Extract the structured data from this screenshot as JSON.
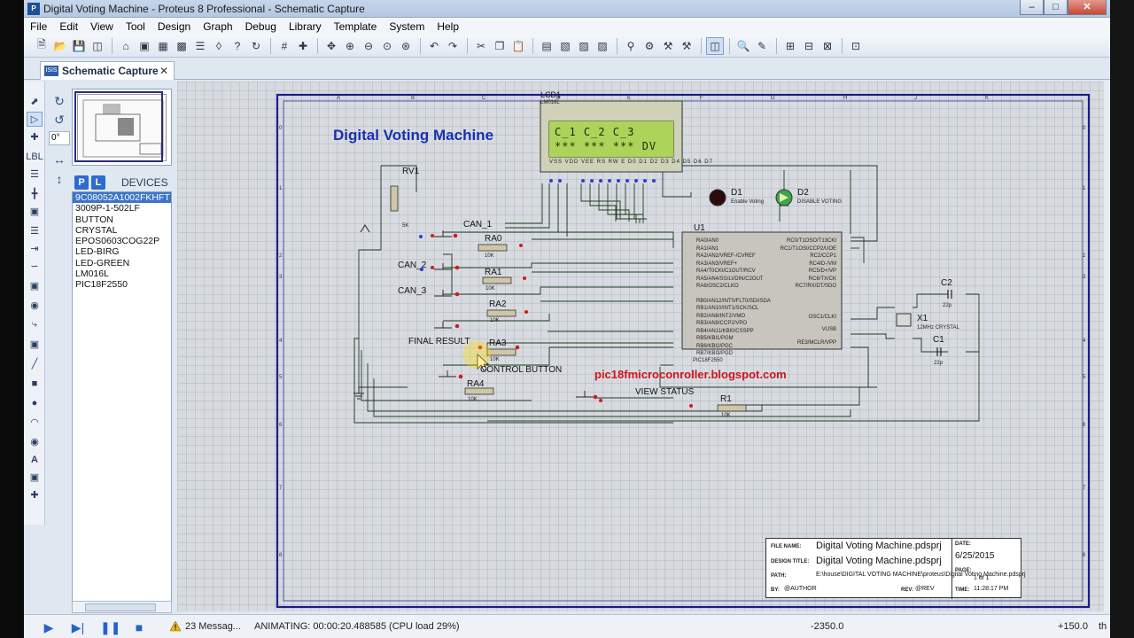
{
  "window": {
    "title": "Digital Voting Machine - Proteus 8 Professional - Schematic Capture",
    "controls": [
      "minimize",
      "maximize",
      "close"
    ]
  },
  "menu": [
    "File",
    "Edit",
    "View",
    "Tool",
    "Design",
    "Graph",
    "Debug",
    "Library",
    "Template",
    "System",
    "Help"
  ],
  "toolbar_icons": [
    "new-icon",
    "open-icon",
    "save-icon",
    "close-project-icon",
    "home-icon",
    "schematic-icon",
    "pcb-icon",
    "gerber-icon",
    "bom-icon",
    "3d-icon",
    "help-icon",
    "refresh-icon",
    "grid-icon",
    "origin-icon",
    "pan-icon",
    "zoom-in-icon",
    "zoom-out-icon",
    "zoom-all-icon",
    "zoom-area-icon",
    "undo-icon",
    "redo-icon",
    "cut-icon",
    "copy-icon",
    "paste-icon",
    "block-copy-icon",
    "block-move-icon",
    "block-rotate-icon",
    "block-delete-icon",
    "pick-icon",
    "make-device-icon",
    "packaging-icon",
    "decompose-icon",
    "wire-autorouter-icon",
    "search-icon",
    "property-assign-icon",
    "new-sheet-icon",
    "remove-sheet-icon",
    "netlist-icon"
  ],
  "tab": {
    "label": "Schematic Capture",
    "badge": "ISIS"
  },
  "overview": {
    "angle": "0°"
  },
  "devices": {
    "buttons": [
      "P",
      "L"
    ],
    "title": "DEVICES",
    "items": [
      "9C08052A1002FKHFT",
      "3009P-1-502LF",
      "BUTTON",
      "CRYSTAL",
      "EPOS0603COG22P",
      "LED-BIRG",
      "LED-GREEN",
      "LM016L",
      "PIC18F2550"
    ],
    "selected_index": 0
  },
  "schematic": {
    "title": "Digital Voting Machine",
    "blog": "pic18fmicroconroller.blogspot.com",
    "lcd": {
      "ref": "LCD1",
      "part": "LM016L",
      "line1": "C_1  C_2  C_3",
      "line2": "***  ***  *** DV",
      "pins": "VSS VDD VEE RS RW E D0 D1 D2 D3 D4 D5 D6 D7"
    },
    "labels": {
      "rv1": "RV1",
      "can1": "CAN_1",
      "can2": "CAN_2",
      "can3": "CAN_3",
      "final": "FINAL RESULT",
      "control": "CONTROL BUTTON",
      "view": "VIEW STATUS",
      "ra0": "RA0",
      "ra1": "RA1",
      "ra2": "RA2",
      "ra3": "RA3",
      "ra4": "RA4",
      "r1": "R1",
      "u1": "U1",
      "u1part": "PIC18F2550",
      "d1": "D1",
      "d1desc": "Enable Voting",
      "d2": "D2",
      "d2desc": "DISABLE VOTING",
      "x1": "X1",
      "x1desc": "12MHz CRYSTAL",
      "c1": "C1",
      "c2": "C2",
      "cap": "22p",
      "res": "10K",
      "rv1val": "5K"
    },
    "u1_left_pins": [
      "RA0/AN0",
      "RA1/AN1",
      "RA2/AN2/VREF-/CVREF",
      "RA3/AN3/VREF+",
      "RA4/T0CKI/C1OUT/RCV",
      "RA5/AN4/SS/LVDIN/C2OUT",
      "RA6/OSC2/CLKO",
      "RB0/AN12/INT0/FLT0/SDI/SDA",
      "RB1/AN10/INT1/SCK/SCL",
      "RB2/AN8/INT2/VMO",
      "RB3/AN9/CCP2/VPO",
      "RB4/AN11/KBI0/CSSPP",
      "RB5/KBI1/PGM",
      "RB6/KBI2/PGC",
      "RB7/KBI3/PGD"
    ],
    "u1_right_pins": [
      "RC0/T1OSO/T13CKI",
      "RC1/T1OSI/CCP2/UOE",
      "RC2/CCP1",
      "RC4/D-/VM",
      "RC5/D+/VP",
      "RC6/TX/CK",
      "RC7/RX/DT/SDO",
      "OSC1/CLKI",
      "VUSB",
      "RE3/MCLR/VPP"
    ],
    "grid_cols": [
      "A",
      "B",
      "C",
      "D",
      "E",
      "F",
      "G",
      "H",
      "J",
      "K"
    ],
    "grid_rows": [
      "0",
      "1",
      "2",
      "3",
      "4",
      "5",
      "6",
      "7",
      "8"
    ]
  },
  "title_block": {
    "file_name_label": "FILE NAME:",
    "file_name": "Digital Voting Machine.pdsprj",
    "design_title_label": "DESIGN TITLE:",
    "design_title": "Digital Voting Machine.pdsprj",
    "path_label": "PATH:",
    "path": "E:\\house\\DIGITAL VOTING MACHINE\\proteus\\Digital Voting Machine.pdsprj",
    "by_label": "BY:",
    "by": "@AUTHOR",
    "rev_label": "REV:",
    "rev": "@REV",
    "date_label": "DATE:",
    "date": "6/25/2015",
    "page_label": "PAGE:",
    "page": "1 of 1",
    "time_label": "TIME:",
    "time": "11:28:17 PM"
  },
  "status": {
    "messages": "23 Messag...",
    "animating": "ANIMATING: 00:00:20.488585 (CPU load 29%)",
    "x": "-2350.0",
    "y": "+150.0",
    "unit": "th"
  }
}
